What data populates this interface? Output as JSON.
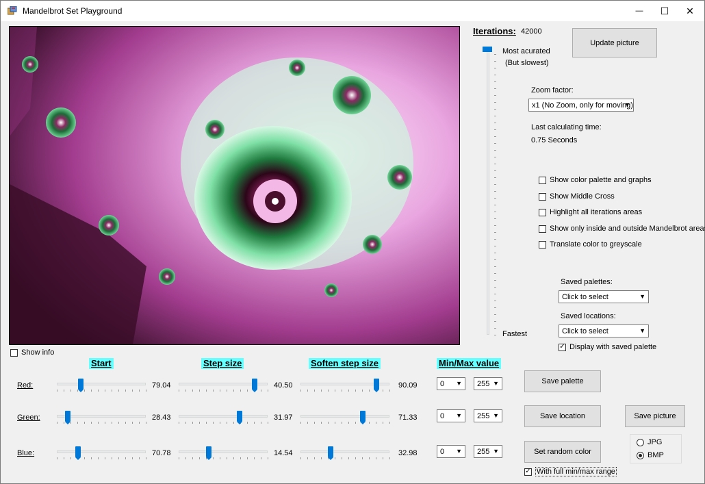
{
  "window": {
    "title": "Mandelbrot Set Playground",
    "minimize_glyph": "—",
    "maximize_glyph": "☐",
    "close_glyph": "✕"
  },
  "iterations": {
    "label": "Iterations:",
    "value": "42000",
    "top_label": "Most acurated",
    "top_sublabel": "(But slowest)",
    "bottom_label": "Fastest"
  },
  "buttons": {
    "update_picture": "Update picture",
    "save_palette": "Save  palette",
    "save_location": "Save location",
    "save_picture": "Save picture",
    "set_random_color": "Set random color"
  },
  "zoom": {
    "label": "Zoom factor:",
    "selected": "x1 (No Zoom, only for moving)"
  },
  "calc": {
    "label": "Last calculating time:",
    "value": "0.75 Seconds"
  },
  "options": [
    {
      "label": "Show color palette and graphs",
      "checked": false
    },
    {
      "label": "Show Middle Cross",
      "checked": false
    },
    {
      "label": "Highlight all iterations areas",
      "checked": false
    },
    {
      "label": "Show only inside and outside Mandelbrot areas",
      "checked": false
    },
    {
      "label": "Translate color to greyscale",
      "checked": false
    }
  ],
  "saved_palettes": {
    "label": "Saved palettes:",
    "selected": "Click to select"
  },
  "saved_locations": {
    "label": "Saved locations:",
    "selected": "Click to select"
  },
  "display_saved_palette": {
    "label": "Display with saved palette",
    "checked": true
  },
  "show_info": {
    "label": "Show info",
    "checked": false
  },
  "headers": {
    "start": "Start",
    "step_size": "Step size",
    "soften_step_size": "Soften step size",
    "min_max_value": "Min/Max value"
  },
  "rows": [
    {
      "label": "Red:",
      "start": "79.04",
      "step": "40.50",
      "soften": "90.09",
      "min": "0",
      "max": "255"
    },
    {
      "label": "Green:",
      "start": "28.43",
      "step": "31.97",
      "soften": "71.33",
      "min": "0",
      "max": "255"
    },
    {
      "label": "Blue:",
      "start": "70.78",
      "step": "14.54",
      "soften": "32.98",
      "min": "0",
      "max": "255"
    }
  ],
  "full_range": {
    "label": "With full min/max range",
    "checked": true
  },
  "format": {
    "options": [
      "JPG",
      "BMP"
    ],
    "selected": "BMP"
  },
  "colors": {
    "accent": "#0078d7",
    "header_highlight": "#66ffff",
    "fractal_pink": "#e9a6e0",
    "fractal_green": "#3fae6a",
    "fractal_dark": "#2a0a1c"
  },
  "icons": {
    "app": "app-icon",
    "dropdown": "chevron-down-icon",
    "check": "checkmark-icon"
  }
}
